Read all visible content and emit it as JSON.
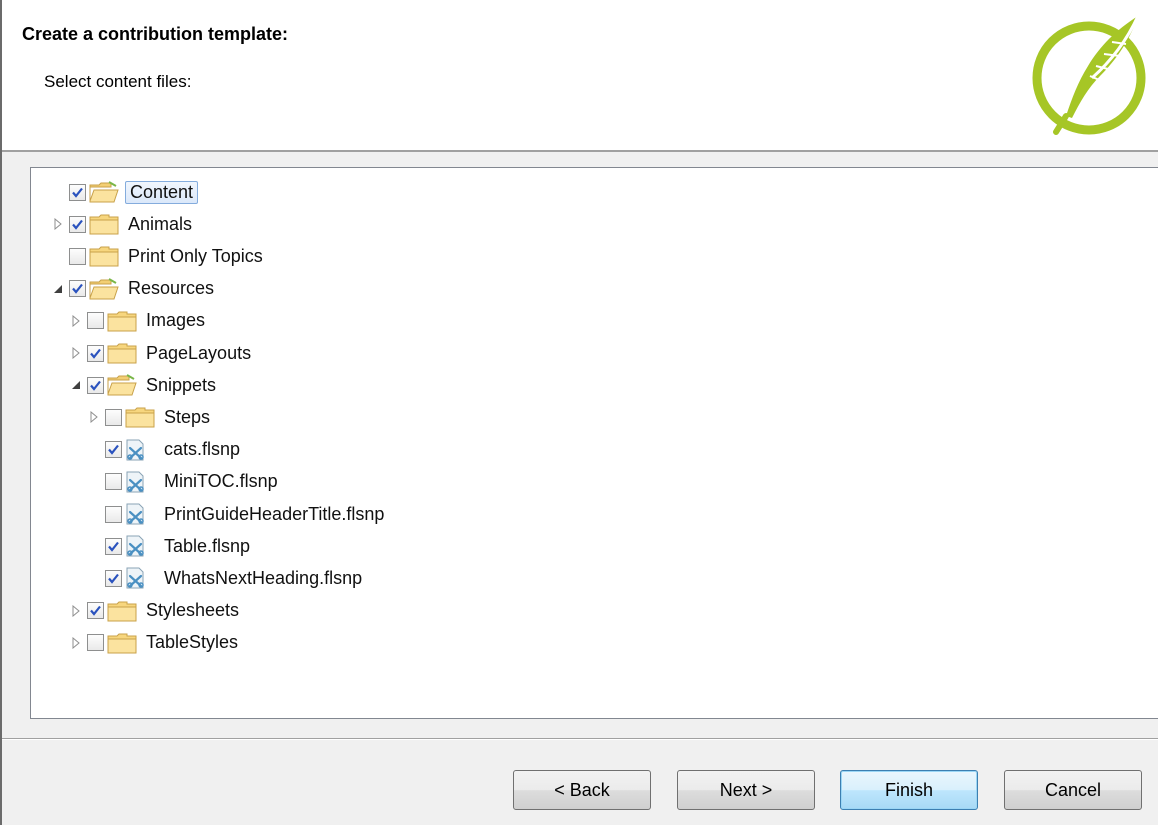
{
  "header": {
    "title": "Create a contribution template:",
    "subtitle": "Select content files:",
    "logo_color": "#a6c626"
  },
  "tree": {
    "items": [
      {
        "label": "Content",
        "depth": 0,
        "expander": "none",
        "checked": true,
        "icon": "open-folder-icon",
        "selected": true
      },
      {
        "label": "Animals",
        "depth": 0,
        "expander": "collapsed",
        "checked": true,
        "icon": "folder-icon",
        "selected": false
      },
      {
        "label": "Print Only Topics",
        "depth": 0,
        "expander": "none",
        "checked": false,
        "icon": "folder-icon",
        "selected": false
      },
      {
        "label": "Resources",
        "depth": 0,
        "expander": "expanded",
        "checked": true,
        "icon": "open-folder-icon",
        "selected": false
      },
      {
        "label": "Images",
        "depth": 1,
        "expander": "collapsed",
        "checked": false,
        "icon": "folder-icon",
        "selected": false
      },
      {
        "label": "PageLayouts",
        "depth": 1,
        "expander": "collapsed",
        "checked": true,
        "icon": "folder-icon",
        "selected": false
      },
      {
        "label": "Snippets",
        "depth": 1,
        "expander": "expanded",
        "checked": true,
        "icon": "open-folder-icon",
        "selected": false
      },
      {
        "label": "Steps",
        "depth": 2,
        "expander": "collapsed",
        "checked": false,
        "icon": "folder-icon",
        "selected": false
      },
      {
        "label": "cats.flsnp",
        "depth": 2,
        "expander": "none",
        "checked": true,
        "icon": "snippet-file-icon",
        "selected": false
      },
      {
        "label": "MiniTOC.flsnp",
        "depth": 2,
        "expander": "none",
        "checked": false,
        "icon": "snippet-file-icon",
        "selected": false
      },
      {
        "label": "PrintGuideHeaderTitle.flsnp",
        "depth": 2,
        "expander": "none",
        "checked": false,
        "icon": "snippet-file-icon",
        "selected": false
      },
      {
        "label": "Table.flsnp",
        "depth": 2,
        "expander": "none",
        "checked": true,
        "icon": "snippet-file-icon",
        "selected": false
      },
      {
        "label": "WhatsNextHeading.flsnp",
        "depth": 2,
        "expander": "none",
        "checked": true,
        "icon": "snippet-file-icon",
        "selected": false
      },
      {
        "label": "Stylesheets",
        "depth": 1,
        "expander": "collapsed",
        "checked": true,
        "icon": "folder-icon",
        "selected": false
      },
      {
        "label": "TableStyles",
        "depth": 1,
        "expander": "collapsed",
        "checked": false,
        "icon": "folder-icon",
        "selected": false
      }
    ]
  },
  "buttons": {
    "back": "< Back",
    "next": "Next >",
    "finish": "Finish",
    "cancel": "Cancel"
  }
}
